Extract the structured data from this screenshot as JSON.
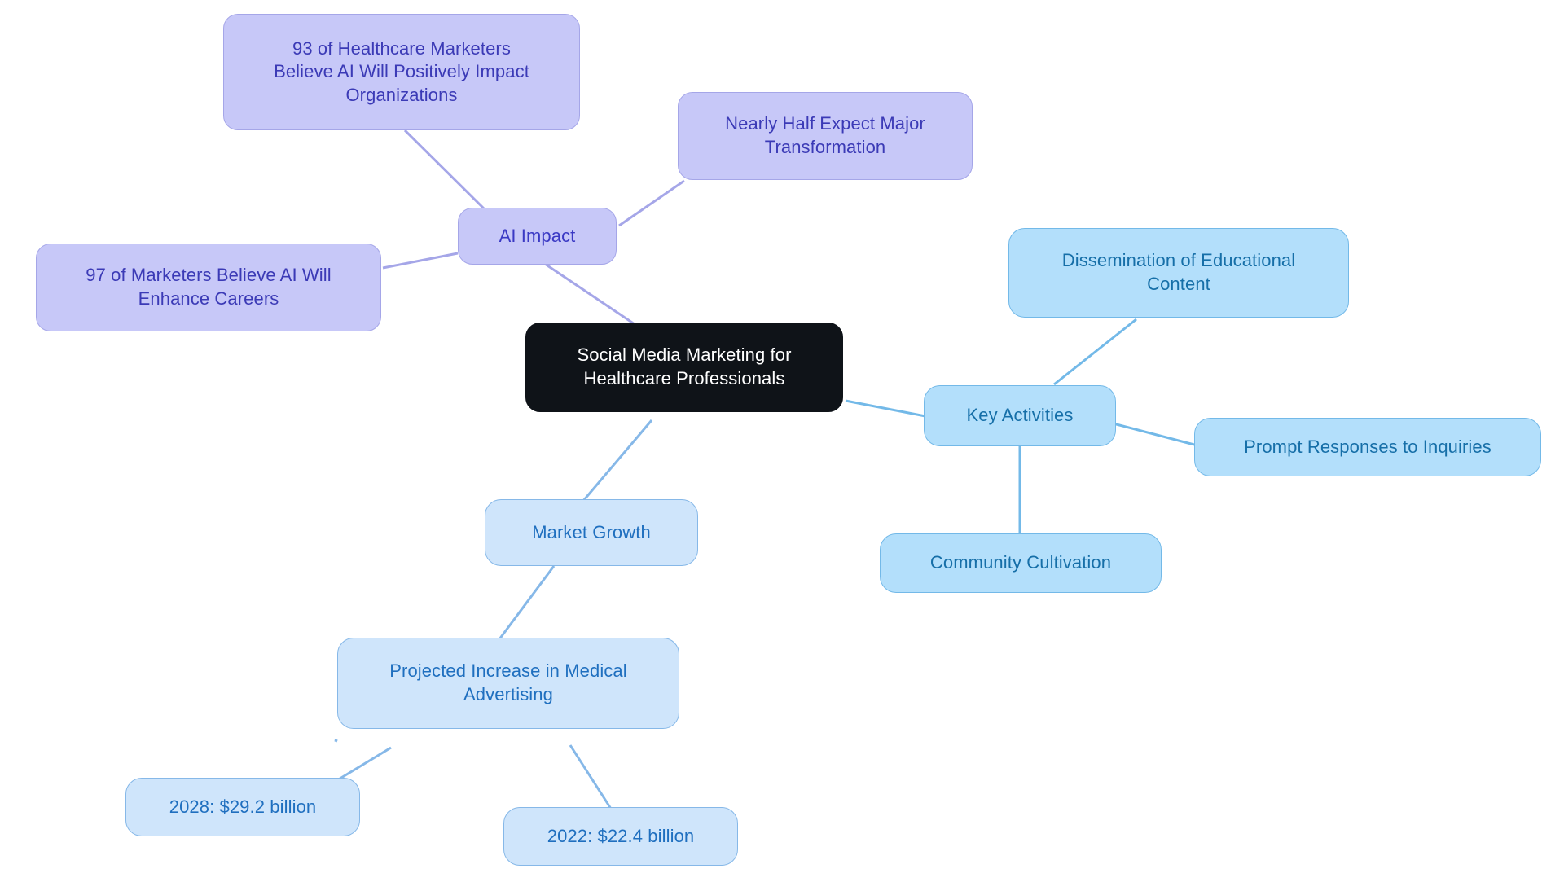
{
  "diagram": {
    "type": "mindmap",
    "title": "Social Media Marketing for Healthcare Professionals",
    "background_color": "#ffffff",
    "root": {
      "id": "root",
      "label": "Social Media Marketing for\nHealthcare Professionals",
      "fill": "#0f1318",
      "text_color": "#ffffff"
    },
    "branches": [
      {
        "id": "ai-impact",
        "label": "AI Impact",
        "fill": "#c7c8f8",
        "stroke": "#a5a6e8",
        "text_color": "#3a39c4",
        "children": [
          {
            "id": "ai-impact-93",
            "label": "93 of Healthcare Marketers\nBelieve AI Will Positively Impact\nOrganizations"
          },
          {
            "id": "ai-impact-transformation",
            "label": "Nearly Half Expect Major\nTransformation"
          },
          {
            "id": "ai-impact-97",
            "label": "97 of Marketers Believe AI Will\nEnhance Careers"
          }
        ]
      },
      {
        "id": "key-activities",
        "label": "Key Activities",
        "fill": "#b3dffb",
        "stroke": "#73b9e8",
        "text_color": "#166fa8",
        "children": [
          {
            "id": "dissemination",
            "label": "Dissemination of Educational\nContent"
          },
          {
            "id": "prompt-responses",
            "label": "Prompt Responses to Inquiries"
          },
          {
            "id": "community-cultivation",
            "label": "Community Cultivation"
          }
        ]
      },
      {
        "id": "market-growth",
        "label": "Market Growth",
        "fill": "#cfe5fb",
        "stroke": "#86b8e8",
        "text_color": "#1f6fbf",
        "children": [
          {
            "id": "projected-increase",
            "label": "Projected Increase in Medical\nAdvertising",
            "children": [
              {
                "id": "y2028",
                "label": "2028: $29.2 billion"
              },
              {
                "id": "y2022",
                "label": "2022: $22.4 billion"
              }
            ]
          }
        ]
      }
    ],
    "edges": [
      {
        "from": "ai-impact",
        "to": "ai-impact-93",
        "color": "#a5a6e8"
      },
      {
        "from": "ai-impact",
        "to": "ai-impact-transformation",
        "color": "#a5a6e8"
      },
      {
        "from": "ai-impact",
        "to": "ai-impact-97",
        "color": "#a5a6e8"
      },
      {
        "from": "root",
        "to": "ai-impact",
        "color": "#a5a6e8"
      },
      {
        "from": "root",
        "to": "key-activities",
        "color": "#73b9e8"
      },
      {
        "from": "key-activities",
        "to": "dissemination",
        "color": "#73b9e8"
      },
      {
        "from": "key-activities",
        "to": "prompt-responses",
        "color": "#73b9e8"
      },
      {
        "from": "key-activities",
        "to": "community-cultivation",
        "color": "#73b9e8"
      },
      {
        "from": "root",
        "to": "market-growth",
        "color": "#86b8e8"
      },
      {
        "from": "market-growth",
        "to": "projected-increase",
        "color": "#86b8e8"
      },
      {
        "from": "projected-increase",
        "to": "y2028",
        "color": "#86b8e8"
      },
      {
        "from": "projected-increase",
        "to": "y2022",
        "color": "#86b8e8"
      }
    ]
  }
}
